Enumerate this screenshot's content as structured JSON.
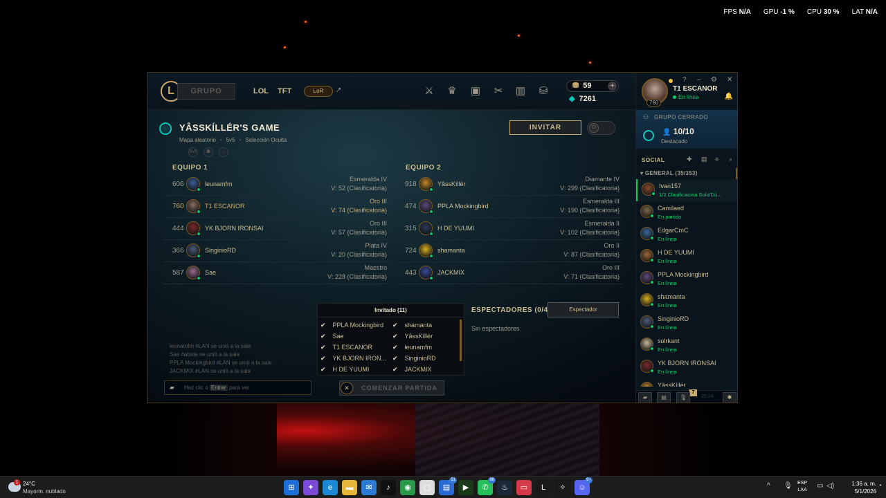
{
  "overlay": {
    "fps_label": "FPS",
    "fps": "N/A",
    "gpu_label": "GPU",
    "gpu": "-1 %",
    "cpu_label": "CPU",
    "cpu": "30 %",
    "lat_label": "LAT",
    "lat": "N/A"
  },
  "topbar": {
    "logo": "L",
    "grupo": "GRUPO",
    "tabs": [
      "LOL",
      "TFT"
    ],
    "lor": "LoR",
    "rp": "59",
    "be": "7261",
    "rp_plus": "+"
  },
  "profile": {
    "name": "T1 ESCANOR",
    "status": "En línea",
    "level": "760",
    "controls": [
      "?",
      "–",
      "⚙",
      "✕"
    ]
  },
  "game": {
    "title": "YÂSSKÍLLÉR'S GAME",
    "map": "Mapa aleatorio",
    "size": "5v5",
    "pick": "Selección Oculta",
    "invite": "INVITAR",
    "mode_icons": [
      "5v5",
      "☗",
      "♨"
    ]
  },
  "teams": [
    {
      "label": "EQUIPO 1",
      "players": [
        {
          "level": "606",
          "name": "leunamfm",
          "rank": "Esmeralda IV",
          "wins": "V: 52 (Clasificatoria)",
          "me": false,
          "color": "#3a5f9a"
        },
        {
          "level": "760",
          "name": "T1 ESCANOR",
          "rank": "Oro III",
          "wins": "V: 74 (Clasificatoria)",
          "me": true,
          "color": "#8a6e60"
        },
        {
          "level": "444",
          "name": "YK BJORN IRONSAI",
          "rank": "Oro III",
          "wins": "V: 57 (Clasificatoria)",
          "me": false,
          "color": "#7a2a2a"
        },
        {
          "level": "366",
          "name": "SinginioRD",
          "rank": "Plata IV",
          "wins": "V: 20 (Clasificatoria)",
          "me": false,
          "color": "#4a5a7a"
        },
        {
          "level": "587",
          "name": "Sae",
          "rank": "Maestro",
          "wins": "V: 228 (Clasificatoria)",
          "me": false,
          "color": "#9a6a8a"
        }
      ]
    },
    {
      "label": "EQUIPO 2",
      "players": [
        {
          "level": "918",
          "name": "YâssKíllér",
          "rank": "Diamante IV",
          "wins": "V: 299 (Clasificatoria)",
          "me": false,
          "color": "#c28a2a"
        },
        {
          "level": "474",
          "name": "PPLA Mockingbird",
          "rank": "Esmeralda III",
          "wins": "V: 190 (Clasificatoria)",
          "me": false,
          "color": "#5a4a7a"
        },
        {
          "level": "315",
          "name": "H DE YUUMI",
          "rank": "Esmeralda II",
          "wins": "V: 102 (Clasificatoria)",
          "me": false,
          "color": "#2a3a5a"
        },
        {
          "level": "724",
          "name": "shamanta",
          "rank": "Oro II",
          "wins": "V: 87 (Clasificatoria)",
          "me": false,
          "color": "#d8b020"
        },
        {
          "level": "443",
          "name": "JACKMIX",
          "rank": "Oro III",
          "wins": "V: 71 (Clasificatoria)",
          "me": false,
          "color": "#3a4a9a"
        }
      ]
    }
  ],
  "chat": {
    "log": [
      "leunamfm #LAN se unió a la sala",
      "Sae #abate se unió a la sala",
      "PPLA Mockingbird #LAN se unió a la sala",
      "JACKMIX #LAN se unió a la sala"
    ],
    "placeholder_a": "Haz clic o",
    "placeholder_key": "Entrar",
    "placeholder_b": "para ver"
  },
  "invited": {
    "header": "Invitado (11)",
    "left": [
      "PPLA Mockingbird",
      "Sae",
      "T1 ESCANOR",
      "YK BJORN IRON...",
      "H DE YUUMI"
    ],
    "right": [
      "shamanta",
      "YâssKíllér",
      "leunamfm",
      "SinginioRD",
      "JACKMIX"
    ]
  },
  "start": {
    "label": "COMENZAR PARTIDA",
    "close": "✕"
  },
  "spectators": {
    "title": "ESPECTADORES (0/4)",
    "button": "Espectador",
    "empty": "Sin espectadores"
  },
  "social": {
    "group_header": "GRUPO CERRADO",
    "group_count": "10/10",
    "group_sub": "Destacado",
    "title": "SOCIAL",
    "general": "▾  GENERAL (35/353)",
    "friends": [
      {
        "name": "Ivan157",
        "status": "1/2 Clasificatoria Solo/Dú...",
        "color": "#8a4a2a",
        "sel": true
      },
      {
        "name": "Camilaed",
        "status": "En partida",
        "color": "#7a6a4a",
        "sel": false
      },
      {
        "name": "EdgarCmC",
        "status": "En línea",
        "color": "#3a6a9a",
        "sel": false
      },
      {
        "name": "H DE YUUMI",
        "status": "En línea",
        "color": "#a06a3a",
        "sel": false
      },
      {
        "name": "PPLA Mockingbird",
        "status": "En línea",
        "color": "#5a4a7a",
        "sel": false
      },
      {
        "name": "shamanta",
        "status": "En línea",
        "color": "#d8b020",
        "sel": false
      },
      {
        "name": "SinginioRD",
        "status": "En línea",
        "color": "#4a5a7a",
        "sel": false
      },
      {
        "name": "solrkant",
        "status": "En línea",
        "color": "#c8b89a",
        "sel": false
      },
      {
        "name": "YK BJORN IRONSAI",
        "status": "En línea",
        "color": "#7a2a2a",
        "sel": false
      },
      {
        "name": "YâssKíllér",
        "status": "",
        "color": "#c28a2a",
        "sel": false
      }
    ],
    "footer_badge": "7",
    "version": "25.24"
  },
  "taskbar": {
    "temp": "24°C",
    "weather": "Mayorm. nublado",
    "weather_badge": "1",
    "lang_top": "ESP",
    "lang_bottom": "LAA",
    "time": "1:36 a. m.",
    "date": "5/1/2026",
    "apps": [
      {
        "glyph": "⊞",
        "color": "#1e6fd9",
        "badge": ""
      },
      {
        "glyph": "✦",
        "color": "#7a4ad6",
        "badge": ""
      },
      {
        "glyph": "e",
        "color": "#1a8ad4",
        "badge": ""
      },
      {
        "glyph": "▬",
        "color": "#e8b43a",
        "badge": ""
      },
      {
        "glyph": "✉",
        "color": "#2a7ad6",
        "badge": ""
      },
      {
        "glyph": "♪",
        "color": "#111",
        "badge": ""
      },
      {
        "glyph": "◉",
        "color": "#2a9a4a",
        "badge": ""
      },
      {
        "glyph": "▢",
        "color": "#ddd",
        "badge": ""
      },
      {
        "glyph": "▤",
        "color": "#2a6ad6",
        "badge": "51"
      },
      {
        "glyph": "▶",
        "color": "#1a3a1a",
        "badge": ""
      },
      {
        "glyph": "✆",
        "color": "#25c05a",
        "badge": "98"
      },
      {
        "glyph": "♨",
        "color": "#1b2838",
        "badge": ""
      },
      {
        "glyph": "▭",
        "color": "#d63a4a",
        "badge": ""
      },
      {
        "glyph": "L",
        "color": "#1a1a1a",
        "badge": ""
      },
      {
        "glyph": "✧",
        "color": "#1a1a1a",
        "badge": ""
      },
      {
        "glyph": "☺",
        "color": "#5865f2",
        "badge": "9+"
      }
    ]
  }
}
